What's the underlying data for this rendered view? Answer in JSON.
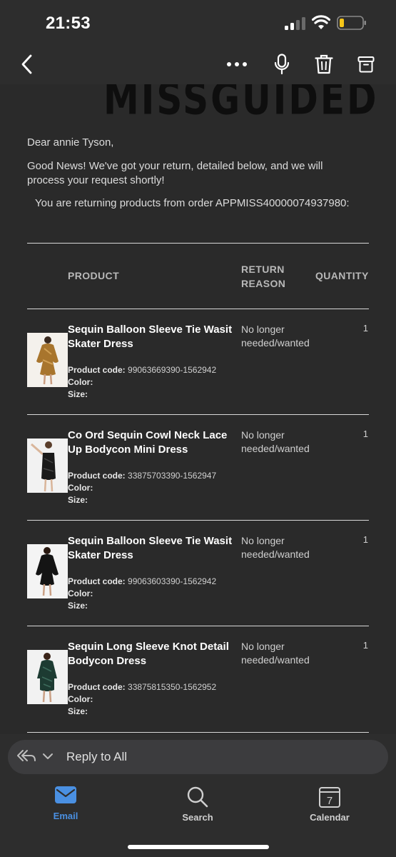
{
  "status": {
    "time": "21:53"
  },
  "email": {
    "brand": "MISSGUIDED",
    "greeting": "Dear annie Tyson,",
    "intro": "Good News! We've got your return, detailed below, and we will process your request shortly!",
    "order_line": "You are returning products from order APPMISS40000074937980:",
    "headers": {
      "product": "PRODUCT",
      "reason": "RETURN REASON",
      "quantity": "QUANTITY"
    },
    "meta_labels": {
      "code": "Product code:",
      "color": "Color:",
      "size": "Size:"
    },
    "items": [
      {
        "name": "Sequin Balloon Sleeve Tie Wasit Skater Dress",
        "code": "99063669390-1562942",
        "reason": "No longer needed/wanted",
        "qty": "1"
      },
      {
        "name": "Co Ord Sequin Cowl Neck Lace Up Bodycon Mini Dress",
        "code": "33875703390-1562947",
        "reason": "No longer needed/wanted",
        "qty": "1"
      },
      {
        "name": "Sequin Balloon Sleeve Tie Wasit Skater Dress",
        "code": "99063603390-1562942",
        "reason": "No longer needed/wanted",
        "qty": "1"
      },
      {
        "name": "Sequin Long Sleeve Knot Detail Bodycon Dress",
        "code": "33875815350-1562952",
        "reason": "No longer needed/wanted",
        "qty": "1"
      }
    ]
  },
  "reply": {
    "label": "Reply to All"
  },
  "tabs": [
    {
      "label": "Email",
      "icon": "email-icon",
      "active": true
    },
    {
      "label": "Search",
      "icon": "search-icon",
      "active": false
    },
    {
      "label": "Calendar",
      "icon": "calendar-icon",
      "active": false,
      "day": "7"
    }
  ],
  "colors": {
    "accent": "#4a90e2",
    "background": "#2a2a2a",
    "bar": "#2d2d2d",
    "battery_low": "#f5c518"
  }
}
